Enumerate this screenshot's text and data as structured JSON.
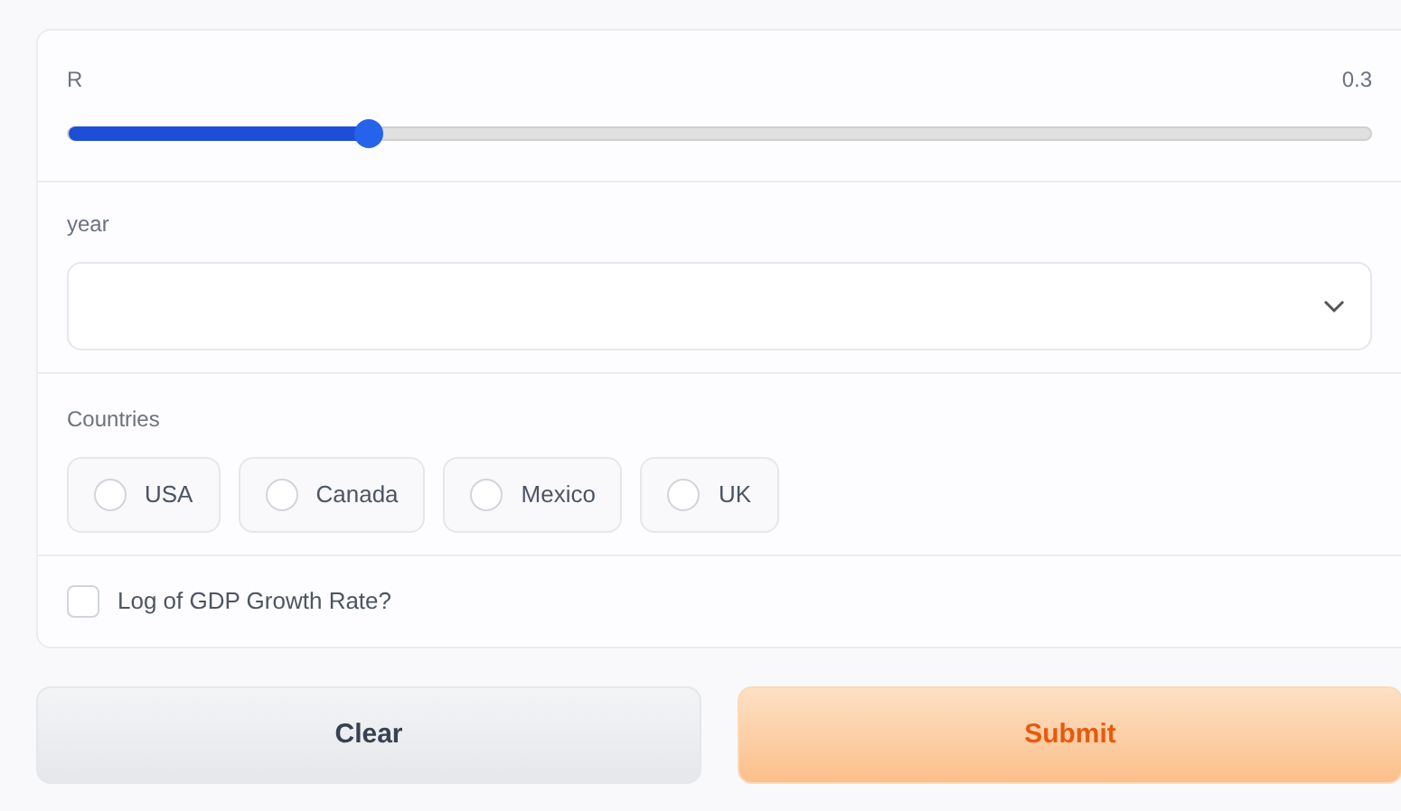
{
  "slider": {
    "label": "R",
    "reading": "0.3",
    "level": 0.23
  },
  "year": {
    "label": "year"
  },
  "countries": {
    "label": "Countries",
    "options": [
      {
        "label": "USA",
        "selected": false
      },
      {
        "label": "Canada",
        "selected": false
      },
      {
        "label": "Mexico",
        "selected": false
      },
      {
        "label": "UK",
        "selected": false
      }
    ]
  },
  "log_option": {
    "label": "Log of GDP Growth Rate?",
    "checked": false
  },
  "buttons": [
    {
      "label": "Clear",
      "kind": "secondary"
    },
    {
      "label": "Submit",
      "kind": "primary"
    }
  ]
}
